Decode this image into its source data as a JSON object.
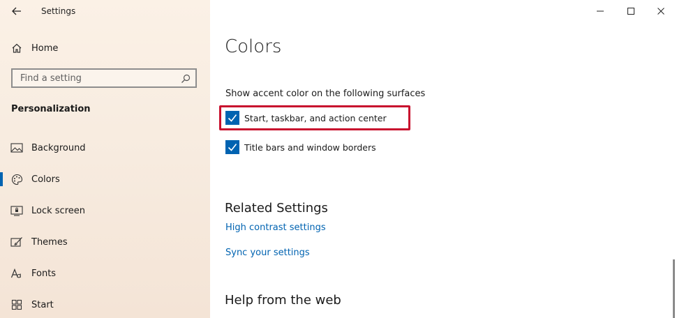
{
  "window": {
    "title": "Settings"
  },
  "sidebar": {
    "home_label": "Home",
    "search_placeholder": "Find a setting",
    "section_title": "Personalization",
    "items": [
      {
        "label": "Background",
        "icon": "picture-icon"
      },
      {
        "label": "Colors",
        "icon": "palette-icon"
      },
      {
        "label": "Lock screen",
        "icon": "lock-screen-icon"
      },
      {
        "label": "Themes",
        "icon": "paintbrush-icon"
      },
      {
        "label": "Fonts",
        "icon": "font-icon"
      },
      {
        "label": "Start",
        "icon": "start-grid-icon"
      }
    ],
    "active_item": "Colors"
  },
  "main": {
    "title": "Colors",
    "accent_heading": "Show accent color on the following surfaces",
    "checkboxes": [
      {
        "label": "Start, taskbar, and action center",
        "checked": true
      },
      {
        "label": "Title bars and window borders",
        "checked": true
      }
    ],
    "related_heading": "Related Settings",
    "related_links": [
      "High contrast settings",
      "Sync your settings"
    ],
    "help_heading": "Help from the web"
  },
  "colors": {
    "accent": "#0063b1",
    "highlight": "#c8102e",
    "sidebar_bg": "#f7ebdf"
  }
}
